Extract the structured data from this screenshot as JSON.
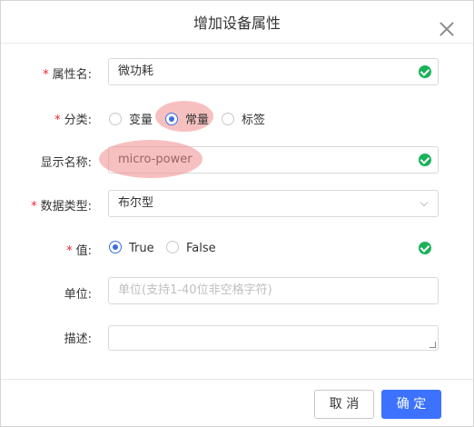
{
  "dialog": {
    "title": "增加设备属性",
    "close_icon": "close-icon"
  },
  "fields": {
    "name": {
      "label": "属性名:",
      "required": "*",
      "value": "微功耗"
    },
    "category": {
      "label": "分类:",
      "required": "*",
      "options": [
        "变量",
        "常量",
        "标签"
      ],
      "selected": "常量"
    },
    "display_name": {
      "label": "显示名称:",
      "value": "micro-power"
    },
    "data_type": {
      "label": "数据类型:",
      "required": "*",
      "value": "布尔型"
    },
    "value": {
      "label": "值:",
      "required": "*",
      "options": [
        "True",
        "False"
      ],
      "selected": "True"
    },
    "unit": {
      "label": "单位:",
      "placeholder": "单位(支持1-40位非空格字符)"
    },
    "description": {
      "label": "描述:",
      "value": ""
    }
  },
  "footer": {
    "cancel_label": "取 消",
    "ok_label": "确 定"
  },
  "colors": {
    "primary": "#3c72ff",
    "valid_check": "#19b25a",
    "required_star": "#f5222d",
    "highlight": "#f08c8c"
  }
}
